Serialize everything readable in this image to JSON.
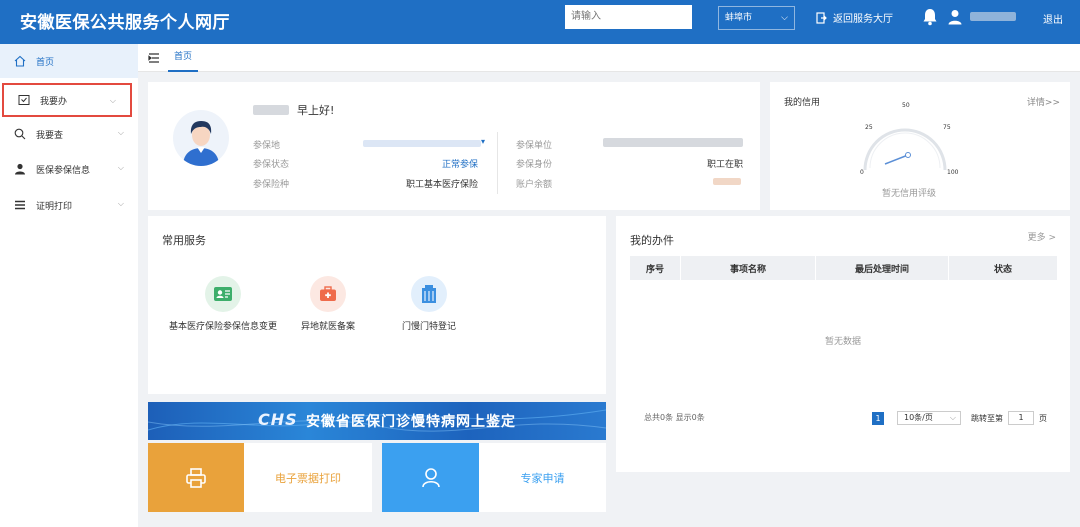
{
  "header": {
    "title": "安徽医保公共服务个人网厅",
    "search_placeholder": "请输入",
    "city": "蚌埠市",
    "return_label": "返回服务大厅",
    "logout_label": "退出"
  },
  "sidebar": {
    "items": [
      {
        "label": "首页",
        "icon": "home-icon"
      },
      {
        "label": "我要办",
        "icon": "todo-icon"
      },
      {
        "label": "我要查",
        "icon": "search-icon"
      },
      {
        "label": "医保参保信息",
        "icon": "person-icon"
      },
      {
        "label": "证明打印",
        "icon": "list-icon"
      }
    ]
  },
  "tabs": {
    "home": "首页"
  },
  "profile": {
    "greeting": "早上好!",
    "fields": [
      {
        "label": "参保地",
        "value": ""
      },
      {
        "label": "参保状态",
        "value": "正常参保"
      },
      {
        "label": "参保险种",
        "value": "职工基本医疗保险"
      },
      {
        "label": "参保单位",
        "value": ""
      },
      {
        "label": "参保身份",
        "value": "职工在职"
      },
      {
        "label": "账户余额",
        "value": ""
      }
    ]
  },
  "credit": {
    "title": "我的信用",
    "detail_link": "详情>>",
    "gauge_ticks": [
      "0",
      "25",
      "50",
      "75",
      "100"
    ],
    "empty_text": "暂无信用评级"
  },
  "services": {
    "title": "常用服务",
    "items": [
      {
        "label": "基本医疗保险参保信息变更",
        "color": "#3dae6b"
      },
      {
        "label": "异地就医备案",
        "color": "#ef6b4b"
      },
      {
        "label": "门慢门特登记",
        "color": "#3b8fe0"
      }
    ]
  },
  "todo": {
    "title": "我的办件",
    "more": "更多 >",
    "columns": [
      "序号",
      "事项名称",
      "最后处理时间",
      "状态"
    ],
    "empty_text": "暂无数据",
    "total": "总共0条 显示0条",
    "current_page": "1",
    "page_size": "10条/页",
    "jump_label": "跳转至第",
    "jump_value": "1",
    "page_suffix": "页"
  },
  "banner": {
    "logo": "CHS",
    "text": "安徽省医保门诊慢特病网上鉴定"
  },
  "tiles": {
    "print_label": "电子票据打印",
    "expert_label": "专家申请"
  },
  "colors": {
    "primary": "#1f6fc4",
    "print_tile": "#e9a23b",
    "expert_tile": "#3ba0f0",
    "highlight_border": "#e34a3f"
  }
}
